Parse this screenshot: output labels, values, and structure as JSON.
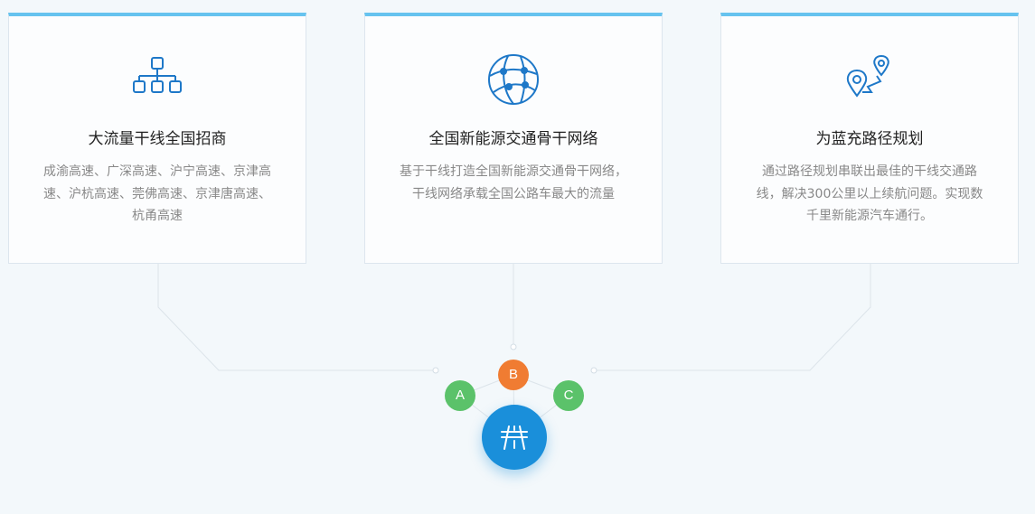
{
  "colors": {
    "accent_bar": "#66c3ef",
    "icon_blue": "#1e78c8",
    "node_green": "#5bc26a",
    "node_orange": "#f07c32",
    "hub_blue": "#1a8fda"
  },
  "cards": [
    {
      "icon": "org-chart-icon",
      "title": "大流量干线全国招商",
      "description": "成渝高速、广深高速、沪宁高速、京津高速、沪杭高速、莞佛高速、京津唐高速、杭甬高速"
    },
    {
      "icon": "globe-network-icon",
      "title": "全国新能源交通骨干网络",
      "description": "基于干线打造全国新能源交通骨干网络，干线网络承载全国公路车最大的流量"
    },
    {
      "icon": "route-pins-icon",
      "title": "为蓝充路径规划",
      "description": "通过路径规划串联出最佳的干线交通路线，解决300公里以上续航问题。实现数千里新能源汽车通行。"
    }
  ],
  "nodes": {
    "a": "A",
    "b": "B",
    "c": "C",
    "hub_icon": "highway-icon"
  }
}
